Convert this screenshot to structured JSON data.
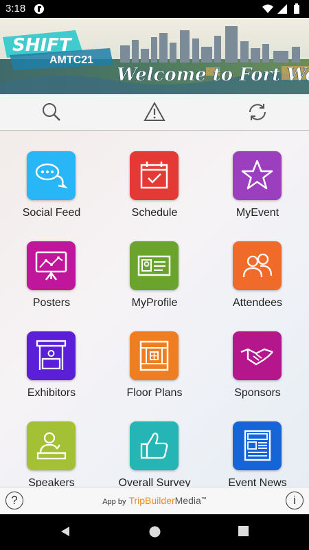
{
  "status_bar": {
    "time": "3:18"
  },
  "banner": {
    "event_name": "SHIFT",
    "event_code": "AMTC21",
    "welcome_text": "Welcome to Fort Worth!"
  },
  "toolbar": {
    "search": "search-icon",
    "alert": "warning-icon",
    "sync": "sync-icon"
  },
  "tiles": [
    {
      "label": "Social Feed",
      "color": "#29b6f6",
      "icon": "chat-bubbles-icon"
    },
    {
      "label": "Schedule",
      "color": "#e53935",
      "icon": "calendar-check-icon"
    },
    {
      "label": "MyEvent",
      "color": "#9c3fbe",
      "icon": "star-icon"
    },
    {
      "label": "Posters",
      "color": "#c0169b",
      "icon": "presentation-chart-icon"
    },
    {
      "label": "MyProfile",
      "color": "#6ba42c",
      "icon": "id-card-icon"
    },
    {
      "label": "Attendees",
      "color": "#f06a2a",
      "icon": "people-icon"
    },
    {
      "label": "Exhibitors",
      "color": "#5a1fd6",
      "icon": "booth-icon"
    },
    {
      "label": "Floor Plans",
      "color": "#ef7d22",
      "icon": "floor-plan-icon"
    },
    {
      "label": "Sponsors",
      "color": "#b5168c",
      "icon": "handshake-icon"
    },
    {
      "label": "Speakers",
      "color": "#a4c135",
      "icon": "speaker-podium-icon"
    },
    {
      "label": "Overall Survey",
      "color": "#26b5b5",
      "icon": "thumbs-up-icon"
    },
    {
      "label": "Event News",
      "color": "#1565d8",
      "icon": "newspaper-icon"
    }
  ],
  "footer": {
    "help": "?",
    "info": "i",
    "app_by": "App by",
    "brand_part1": "TripBuilder",
    "brand_part2": "Media",
    "trademark": "™"
  }
}
